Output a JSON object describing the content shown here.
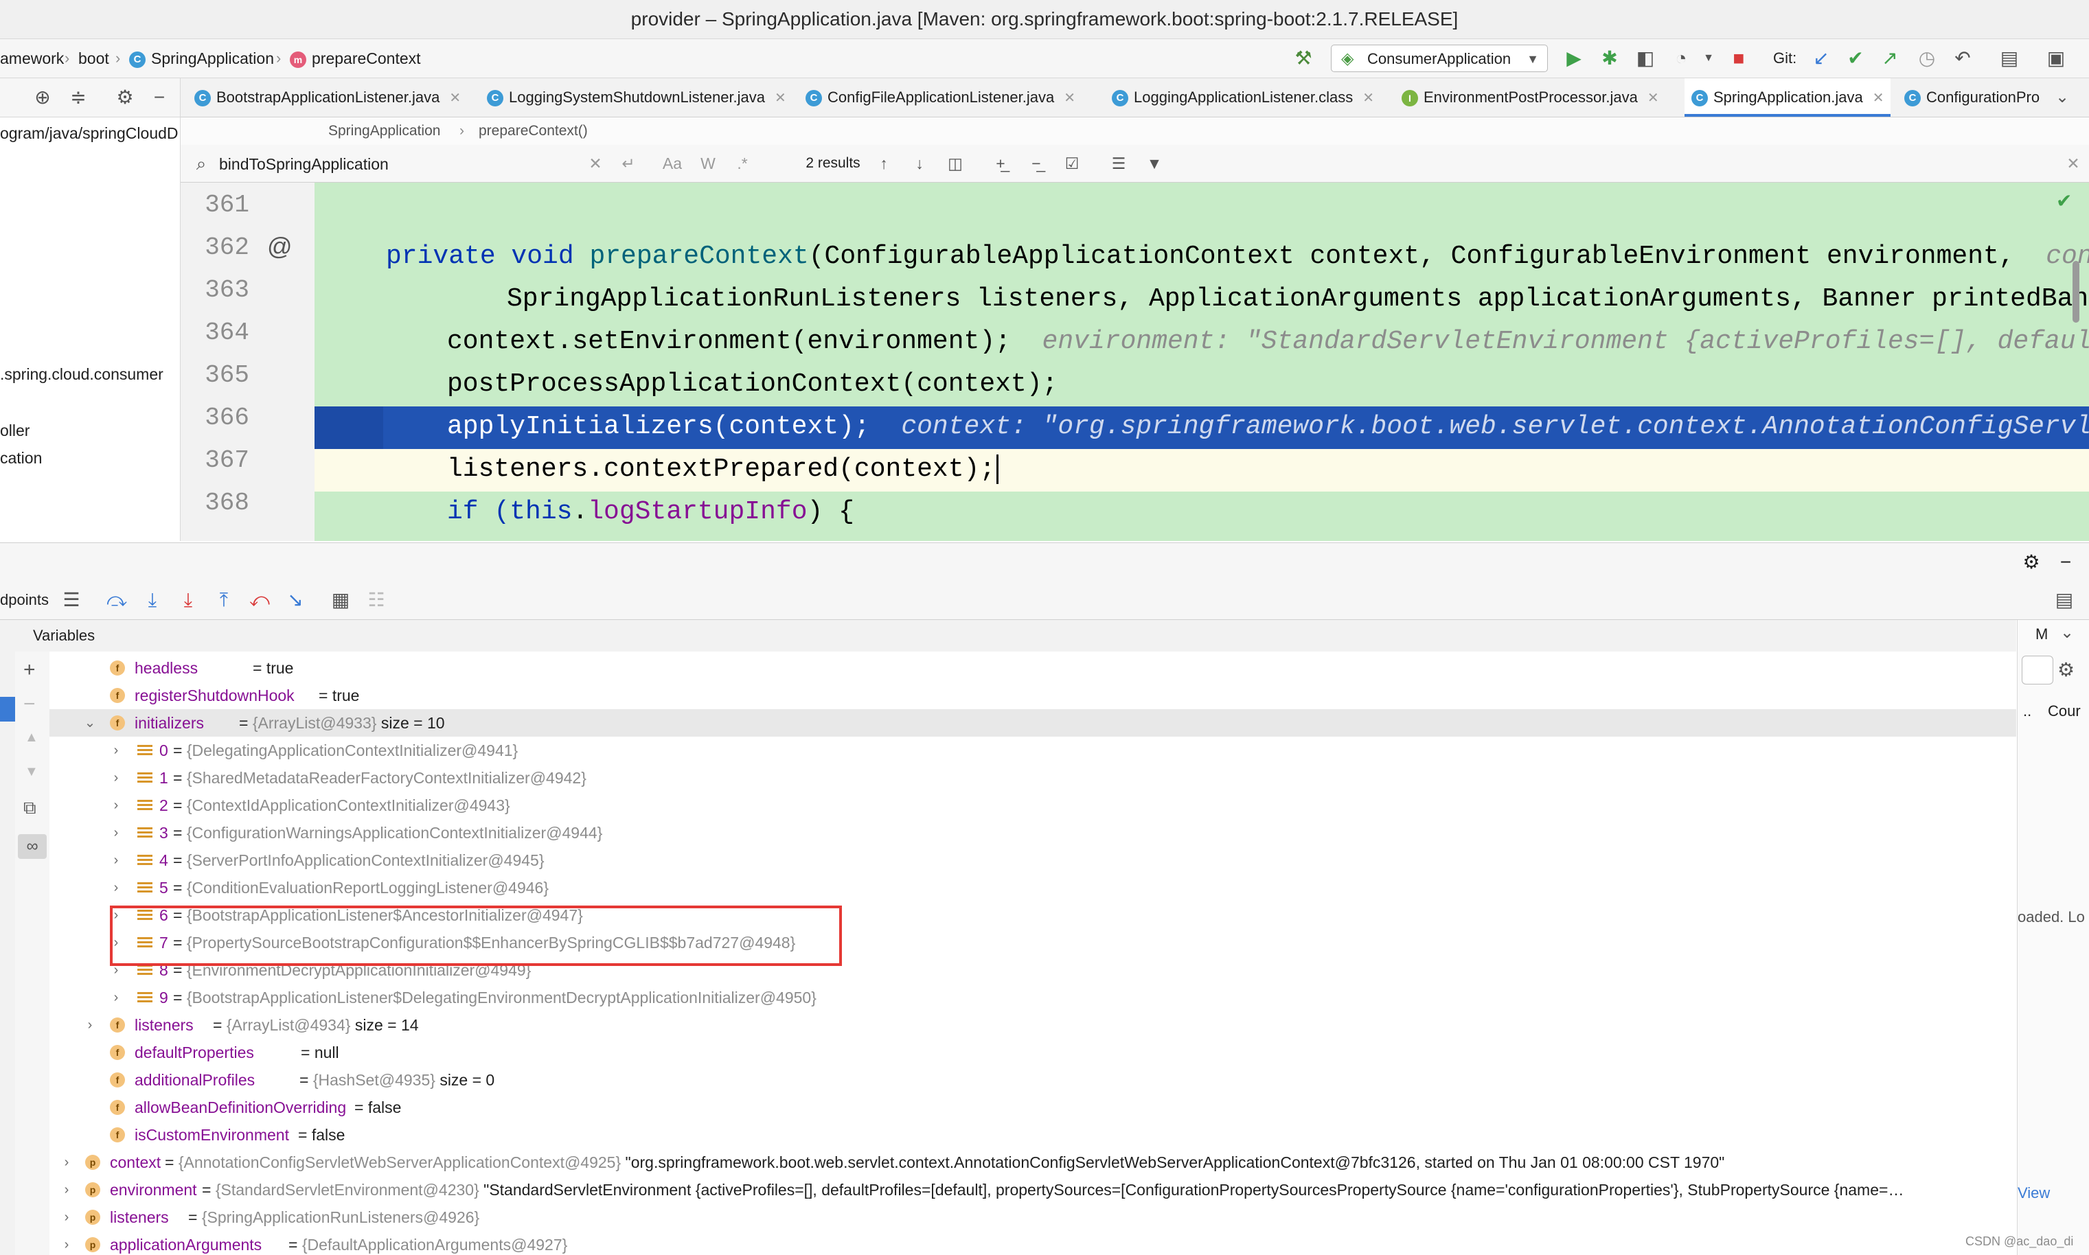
{
  "window": {
    "title": "provider – SpringApplication.java [Maven: org.springframework.boot:spring-boot:2.1.7.RELEASE]"
  },
  "nav": {
    "crumbs": [
      "amework",
      "boot",
      "SpringApplication",
      "prepareContext"
    ],
    "run_config": "ConsumerApplication",
    "git_label": "Git:"
  },
  "project": {
    "path": "ogram/java/springCloudD",
    "items": [
      ".spring.cloud.consumer",
      "oller",
      "cation"
    ]
  },
  "tabs": [
    {
      "label": "BootstrapApplicationListener.java",
      "icon": "C"
    },
    {
      "label": "LoggingSystemShutdownListener.java",
      "icon": "C"
    },
    {
      "label": "ConfigFileApplicationListener.java",
      "icon": "C"
    },
    {
      "label": "LoggingApplicationListener.class",
      "icon": "C"
    },
    {
      "label": "EnvironmentPostProcessor.java",
      "icon": "I"
    },
    {
      "label": "SpringApplication.java",
      "icon": "C"
    },
    {
      "label": "ConfigurationPro",
      "icon": "C"
    }
  ],
  "editor_crumb": {
    "cls": "SpringApplication",
    "method": "prepareContext()"
  },
  "search": {
    "query": "bindToSpringApplication",
    "results": "2 results",
    "opt_case": "Aa",
    "opt_word": "W",
    "opt_regex": ".*"
  },
  "code": {
    "lines": [
      "361",
      "362",
      "363",
      "364",
      "365",
      "366",
      "367",
      "368"
    ],
    "l362a": "private void ",
    "l362b": "prepareContext",
    "l362c": "(ConfigurableApplicationContext context, ConfigurableEnvironment environment,  ",
    "l362d": "contex",
    "l363": "SpringApplicationRunListeners listeners, ApplicationArguments applicationArguments, Banner printedBanner",
    "l364a": "context.setEnvironment(environment);  ",
    "l364b": "environment: \"StandardServletEnvironment {activeProfiles=[], defaultPro",
    "l365": "postProcessApplicationContext(context);",
    "l366a": "applyInitializers(context);  ",
    "l366b": "context: \"org.springframework.boot.web.servlet.context.AnnotationConfigServletWe",
    "l367": "listeners.contextPrepared(context);",
    "l368a": "if (",
    "l368b": "this",
    "l368c": ".",
    "l368d": "logStartupInfo",
    "l368e": ") {"
  },
  "debugger": {
    "tab": "dpoints",
    "variables_title": "Variables",
    "right_tab": "M",
    "right_col": "Cour",
    "right_dots": "..",
    "right_loaded": "oaded. Lo",
    "right_view": "View",
    "vars": [
      {
        "name": "headless",
        "rest": " = true"
      },
      {
        "name": "registerShutdownHook",
        "rest": " = true"
      },
      {
        "name": "initializers",
        "type": "{ArrayList@4933}",
        "extra": "size = 10"
      },
      {
        "name": "0",
        "type": "{DelegatingApplicationContextInitializer@4941}"
      },
      {
        "name": "1",
        "type": "{SharedMetadataReaderFactoryContextInitializer@4942}"
      },
      {
        "name": "2",
        "type": "{ContextIdApplicationContextInitializer@4943}"
      },
      {
        "name": "3",
        "type": "{ConfigurationWarningsApplicationContextInitializer@4944}"
      },
      {
        "name": "4",
        "type": "{ServerPortInfoApplicationContextInitializer@4945}"
      },
      {
        "name": "5",
        "type": "{ConditionEvaluationReportLoggingListener@4946}"
      },
      {
        "name": "6",
        "type": "{BootstrapApplicationListener$AncestorInitializer@4947}"
      },
      {
        "name": "7",
        "type": "{PropertySourceBootstrapConfiguration$$EnhancerBySpringCGLIB$$b7ad727@4948}"
      },
      {
        "name": "8",
        "type": "{EnvironmentDecryptApplicationInitializer@4949}"
      },
      {
        "name": "9",
        "type": "{BootstrapApplicationListener$DelegatingEnvironmentDecryptApplicationInitializer@4950}"
      },
      {
        "name": "listeners",
        "type": "{ArrayList@4934}",
        "extra": "size = 14"
      },
      {
        "name": "defaultProperties",
        "rest": " = null"
      },
      {
        "name": "additionalProfiles",
        "type": "{HashSet@4935}",
        "extra": "size = 0"
      },
      {
        "name": "allowBeanDefinitionOverriding",
        "rest": " = false"
      },
      {
        "name": "isCustomEnvironment",
        "rest": " = false"
      },
      {
        "name": "context",
        "type": "{AnnotationConfigServletWebServerApplicationContext@4925}",
        "extra": "\"org.springframework.boot.web.servlet.context.AnnotationConfigServletWebServerApplicationContext@7bfc3126, started on Thu Jan 01 08:00:00 CST 1970\""
      },
      {
        "name": "environment",
        "type": "{StandardServletEnvironment@4230}",
        "extra": "\"StandardServletEnvironment {activeProfiles=[], defaultProfiles=[default], propertySources=[ConfigurationPropertySourcesPropertySource {name='configurationProperties'}, StubPropertySource {name=…"
      },
      {
        "name": "listeners",
        "type": "{SpringApplicationRunListeners@4926}"
      },
      {
        "name": "applicationArguments",
        "type": "{DefaultApplicationArguments@4927}"
      }
    ]
  },
  "watermark": "CSDN @ac_dao_di",
  "colors": {
    "accent": "#3a7bd5",
    "highlight": "#2154b3",
    "editor_bg": "#c8ecc8",
    "box": "#e53935"
  }
}
